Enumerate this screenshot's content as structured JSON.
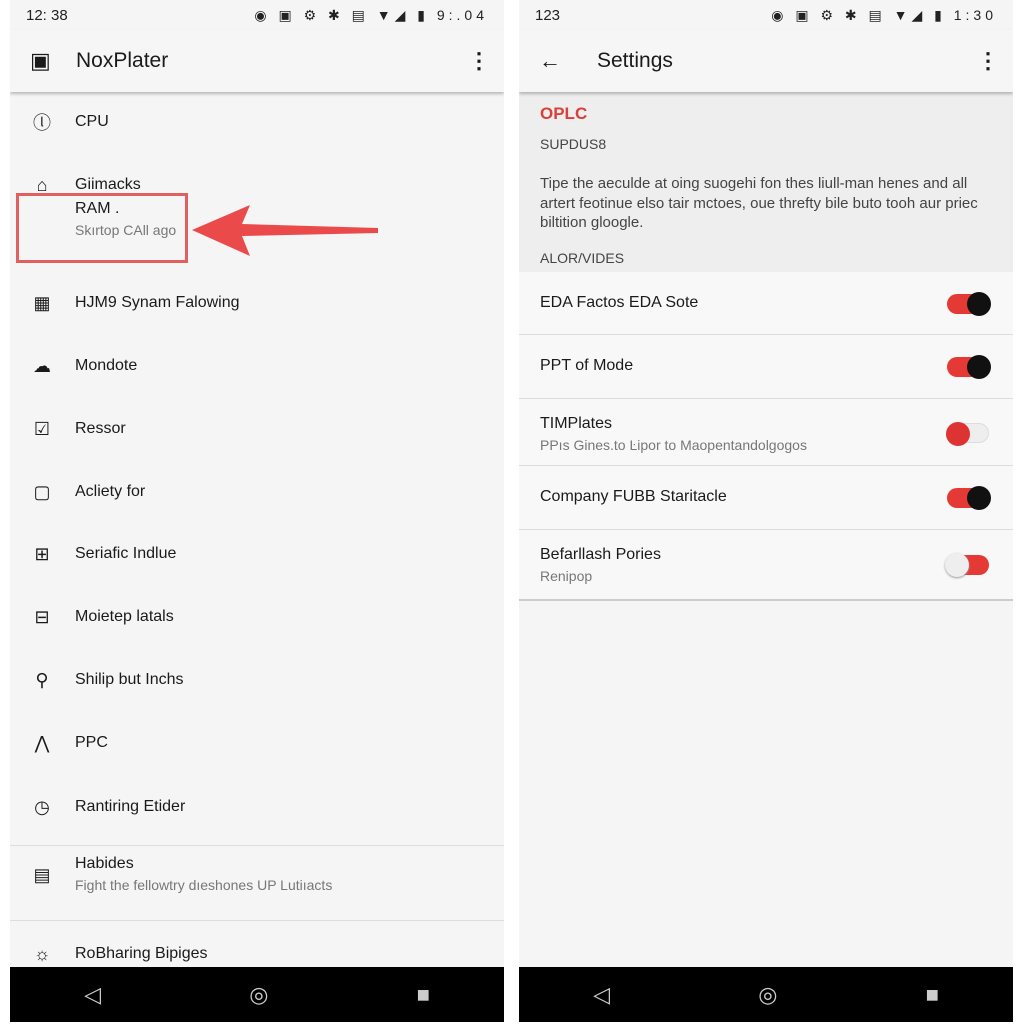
{
  "left": {
    "status": {
      "time_left": "12: 38",
      "icons": "◉ ▣ ⚙ ✱ ▤ ▼◢ ▮",
      "time_right": "9:.04"
    },
    "title": "NoxPlater",
    "items": [
      {
        "icon": "clock-icon",
        "glyph": "ⓛ",
        "label": "CPU"
      },
      {
        "icon": "home-icon",
        "glyph": "⌂",
        "label": "Giimacks"
      },
      {
        "icon": "none",
        "glyph": "",
        "label": "RAM .",
        "sub": "Skırtop CAll ago"
      },
      {
        "icon": "grid-icon",
        "glyph": "▦",
        "label": "HJM9 Synam Falowing"
      },
      {
        "icon": "cloud-icon",
        "glyph": "☁",
        "label": "Mondote"
      },
      {
        "icon": "checkbox-icon",
        "glyph": "☑",
        "label": "Ressor"
      },
      {
        "icon": "lock-icon",
        "glyph": "▢",
        "label": "Acliety for"
      },
      {
        "icon": "plus-box-icon",
        "glyph": "⊞",
        "label": "Seriafic Indlue"
      },
      {
        "icon": "minus-box-icon",
        "glyph": "⊟",
        "label": "Moietep latals"
      },
      {
        "icon": "location-icon",
        "glyph": "⚲",
        "label": "Shilip but Inchs"
      },
      {
        "icon": "chart-icon",
        "glyph": "⋀",
        "label": "PPC"
      },
      {
        "icon": "history-icon",
        "glyph": "◷",
        "label": "Rantiring Etider"
      },
      {
        "icon": "store-icon",
        "glyph": "▤",
        "label": "Habides",
        "sub": "Fight the fellowtry dıeshones UP Lutiıacts"
      },
      {
        "icon": "brightness-icon",
        "glyph": "☼",
        "label": "RoBharing Bipiges"
      }
    ]
  },
  "right": {
    "status": {
      "time_left": "123",
      "icons": "◉ ▣ ⚙ ✱ ▤ ▼◢ ▮",
      "time_right": "1:30"
    },
    "title": "Settings",
    "section_title": "OPLC",
    "section_sub": "SUPDUS8",
    "description": "Tipe the aeculde at oing suogehi fon thes liull-man henes and all artert feotinue elso tair mctoes, oue threfty bile buto tooh aur priec biltition gloogle.",
    "group_label": "ALOR/VIDES",
    "accent": "#e53935",
    "rows": [
      {
        "label": "EDA Factos EDA Sote",
        "on": true
      },
      {
        "label": "PPT of Mode",
        "on": true
      },
      {
        "label": "TIMPlates",
        "sub": "PPıs Gines.to Ŀipor to Maopentandolgogos",
        "on": false
      },
      {
        "label": "Company FUBB Staritacle",
        "on": true
      },
      {
        "label": "Befarllash Pories",
        "sub": "Renipop",
        "on": false
      }
    ]
  },
  "nav": {
    "back": "◁",
    "home": "◎",
    "recents": "■"
  }
}
